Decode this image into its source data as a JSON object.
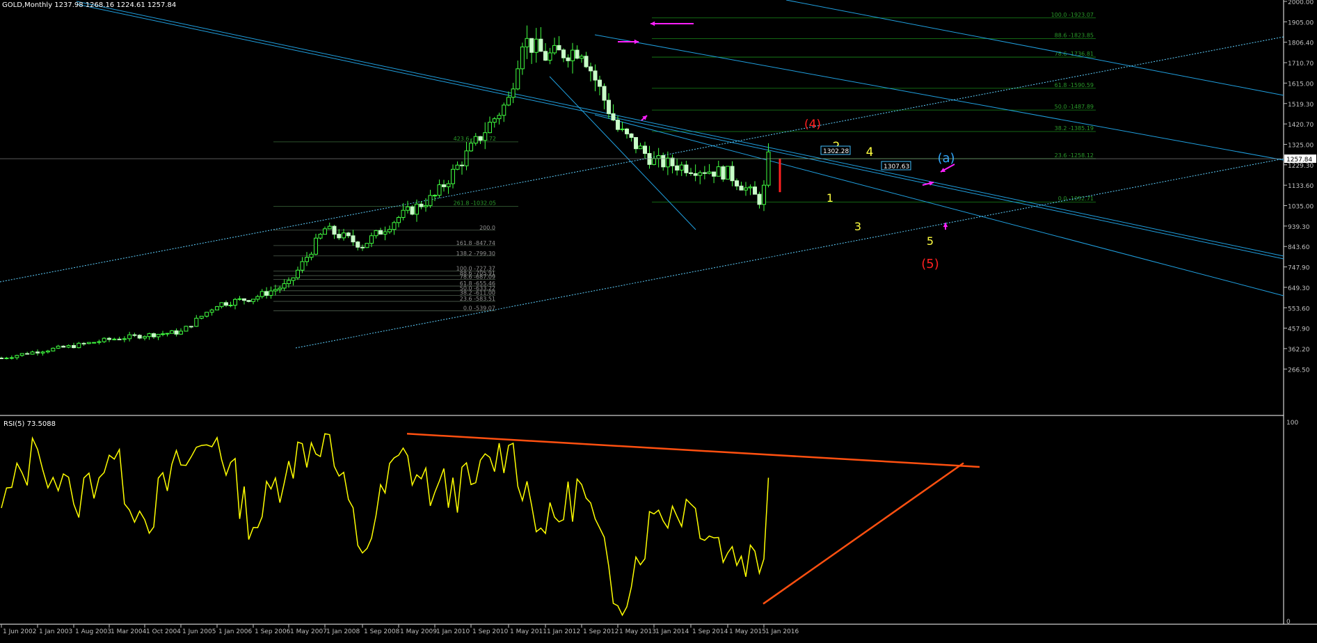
{
  "header": {
    "symbol_line": "GOLD,Monthly  1237.98 1268.16 1224.61 1257.84"
  },
  "rsi_panel": {
    "label": "RSI(5) 73.5088",
    "scale_top": "100",
    "scale_bottom": "0"
  },
  "price_axis": [
    "2000.00",
    "1905.00",
    "1806.40",
    "1710.70",
    "1615.00",
    "1519.30",
    "1420.70",
    "1325.00",
    "1229.30",
    "1133.60",
    "1035.00",
    "939.30",
    "843.60",
    "747.90",
    "649.30",
    "553.60",
    "457.90",
    "362.20",
    "266.50"
  ],
  "current_price": "1257.84",
  "time_axis": [
    "1 Jun 2002",
    "1 Jan 2003",
    "1 Aug 2003",
    "1 Mar 2004",
    "1 Oct 2004",
    "1 Jun 2005",
    "1 Jan 2006",
    "1 Sep 2006",
    "1 May 2007",
    "1 Jan 2008",
    "1 Sep 2008",
    "1 May 2009",
    "1 Jan 2010",
    "1 Sep 2010",
    "1 May 2011",
    "1 Jan 2012",
    "1 Sep 2012",
    "1 May 2013",
    "1 Jan 2014",
    "1 Sep 2014",
    "1 May 2015",
    "1 Jan 2016"
  ],
  "fib_right": [
    {
      "text": "100.0 -1923.07",
      "price": 1923.07
    },
    {
      "text": "88.6 -1823.85",
      "price": 1823.85
    },
    {
      "text": "78.6 -1736.81",
      "price": 1736.81
    },
    {
      "text": "61.8 -1590.59",
      "price": 1590.59
    },
    {
      "text": "50.0 -1487.89",
      "price": 1487.89
    },
    {
      "text": "38.2 -1385.19",
      "price": 1385.19
    },
    {
      "text": "23.6 -1258.12",
      "price": 1258.12
    },
    {
      "text": "0.0 -1052.71",
      "price": 1052.71
    }
  ],
  "fib_ext": [
    {
      "text": "423.6 -1336.72",
      "price": 1336.72
    },
    {
      "text": "261.8 -1032.05",
      "price": 1032.05
    }
  ],
  "fib_left": [
    {
      "text": "200.0",
      "price": 920
    },
    {
      "text": "161.8 -847.74",
      "price": 848
    },
    {
      "text": "138.2 -799.30",
      "price": 799.3
    },
    {
      "text": "100.0 -727.37",
      "price": 727.37
    },
    {
      "text": "88.6 -705.91",
      "price": 705.91
    },
    {
      "text": "78.6 -687.09",
      "price": 687.09
    },
    {
      "text": "61.8 -655.46",
      "price": 655.46
    },
    {
      "text": "50.0 -633.22",
      "price": 633.22
    },
    {
      "text": "38.2 -611.00",
      "price": 611.0
    },
    {
      "text": "23.6 -583.51",
      "price": 583.51
    },
    {
      "text": "0.0 -539.07",
      "price": 539.07
    }
  ],
  "price_boxes": [
    "1307.63",
    "1302.28"
  ],
  "wave_labels": [
    {
      "text": "(4)",
      "color": "#ff2020"
    },
    {
      "text": "2",
      "color": "#ffff40"
    },
    {
      "text": "4",
      "color": "#ffff40"
    },
    {
      "text": "(a)",
      "color": "#2fa8ff"
    },
    {
      "text": "1",
      "color": "#ffff40"
    },
    {
      "text": "3",
      "color": "#ffff40"
    },
    {
      "text": "5",
      "color": "#ffff40"
    },
    {
      "text": "(5)",
      "color": "#ff2020"
    }
  ],
  "colors": {
    "candle": "#40ff40",
    "channel": "#20a0e0",
    "rsi": "#ffff00",
    "trend": "#ff5010",
    "fib": "#1a8a1a",
    "arrow": "#ff20ff",
    "grid_text": "#c0c0c0"
  },
  "chart_data": {
    "type": "candlestick",
    "title": "GOLD,Monthly",
    "ohlc_last": {
      "open": 1237.98,
      "high": 1268.16,
      "low": 1224.61,
      "close": 1257.84
    },
    "close_series": {
      "dates": [
        "2002-06",
        "2003-01",
        "2003-08",
        "2004-03",
        "2004-10",
        "2005-06",
        "2006-01",
        "2006-09",
        "2007-05",
        "2008-01",
        "2008-09",
        "2009-05",
        "2010-01",
        "2010-09",
        "2011-05",
        "2011-08",
        "2012-01",
        "2012-09",
        "2013-05",
        "2014-01",
        "2014-09",
        "2015-05",
        "2015-12",
        "2016-01",
        "2016-02"
      ],
      "values": [
        318,
        350,
        375,
        405,
        425,
        440,
        570,
        600,
        665,
        925,
        850,
        980,
        1080,
        1305,
        1535,
        1825,
        1740,
        1775,
        1395,
        1245,
        1215,
        1190,
        1062,
        1118,
        1258
      ]
    },
    "rsi": {
      "name": "RSI(5)",
      "last": 73.5088,
      "dates": [
        "2002-06",
        "2003-01",
        "2003-08",
        "2004-03",
        "2004-10",
        "2005-06",
        "2006-01",
        "2006-09",
        "2007-05",
        "2008-01",
        "2008-09",
        "2009-05",
        "2010-01",
        "2010-09",
        "2011-05",
        "2012-01",
        "2012-09",
        "2013-05",
        "2014-01",
        "2014-09",
        "2015-05",
        "2016-01",
        "2016-02"
      ],
      "values": [
        58,
        88,
        60,
        85,
        52,
        80,
        94,
        48,
        82,
        96,
        35,
        85,
        66,
        70,
        90,
        45,
        70,
        8,
        55,
        60,
        35,
        32,
        73.5
      ]
    },
    "ylim_price": [
      266.5,
      2000
    ],
    "ylim_rsi": [
      0,
      100
    ]
  }
}
